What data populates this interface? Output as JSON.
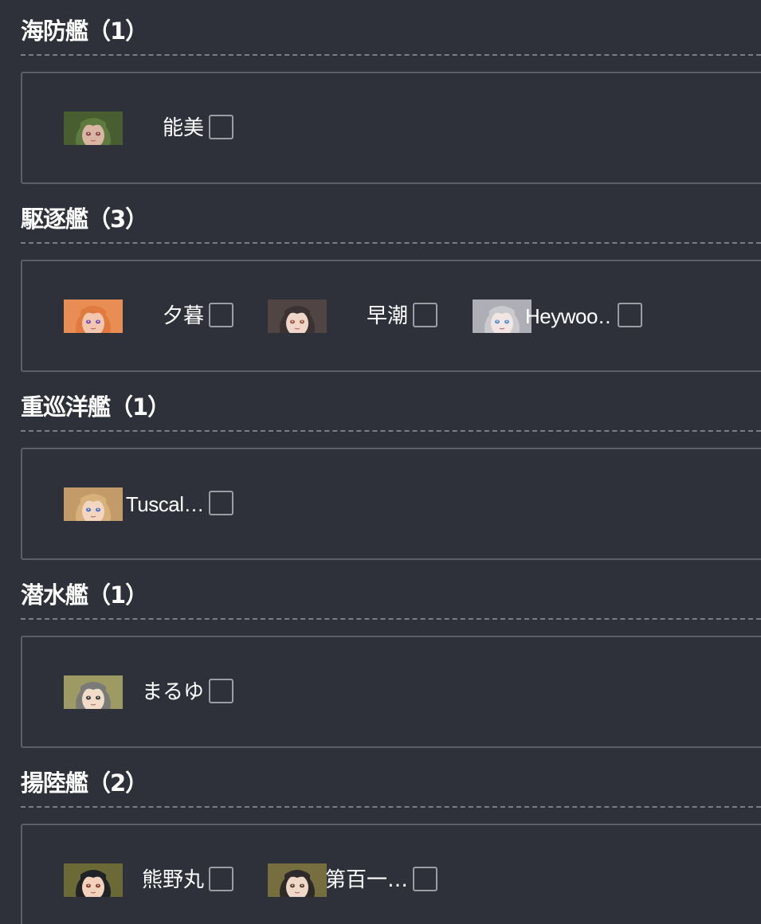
{
  "sections": [
    {
      "title": "海防艦（1）",
      "ships": [
        {
          "name": "能美",
          "checked": false,
          "palette": [
            "#5f7a3e",
            "#2d3b21",
            "#d9b5a3",
            "#8a3d45"
          ],
          "portrait": "green-hair"
        }
      ]
    },
    {
      "title": "駆逐艦（3）",
      "ships": [
        {
          "name": "夕暮",
          "checked": false,
          "palette": [
            "#e07a3f",
            "#f1a56b",
            "#f2c7b0",
            "#7b4bb7"
          ],
          "portrait": "orange-hair"
        },
        {
          "name": "早潮",
          "checked": false,
          "palette": [
            "#3a3233",
            "#6b5d58",
            "#f0d6c8",
            "#a05a3c"
          ],
          "portrait": "dark-hair"
        },
        {
          "name": "Heywoo…",
          "checked": false,
          "palette": [
            "#c9c9ce",
            "#8c8f99",
            "#f1e6e4",
            "#5a8fd0"
          ],
          "portrait": "silver-hair"
        }
      ]
    },
    {
      "title": "重巡洋艦（1）",
      "ships": [
        {
          "name": "Tuscal…",
          "checked": false,
          "palette": [
            "#d7b07a",
            "#a98052",
            "#f3d6c1",
            "#4b6fc2"
          ],
          "portrait": "blonde-hair"
        }
      ]
    },
    {
      "title": "潜水艦（1）",
      "ships": [
        {
          "name": "まるゆ",
          "checked": false,
          "palette": [
            "#7a7a78",
            "#c9c24a",
            "#f0dcc8",
            "#3a3a3a"
          ],
          "portrait": "grey-bob"
        }
      ]
    },
    {
      "title": "揚陸艦（2）",
      "ships": [
        {
          "name": "熊野丸",
          "checked": false,
          "palette": [
            "#1f2226",
            "#c7c24a",
            "#f2d2bd",
            "#8b3a2e"
          ],
          "portrait": "black-hair"
        },
        {
          "name": "第百一…",
          "checked": false,
          "palette": [
            "#2e2a2a",
            "#cfc25a",
            "#f0d8c8",
            "#5a3d2e"
          ],
          "portrait": "dark-long-hair"
        }
      ]
    }
  ]
}
